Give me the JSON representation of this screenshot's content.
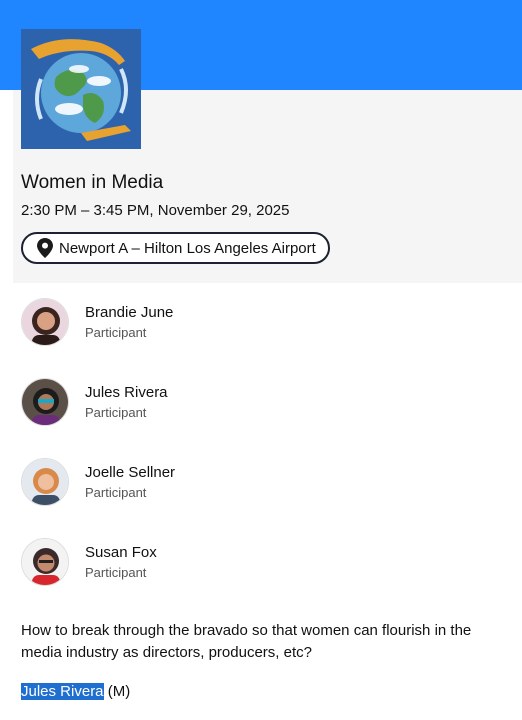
{
  "event": {
    "title": "Women in Media",
    "datetime": "2:30 PM – 3:45 PM, November 29, 2025",
    "location": "Newport A – Hilton Los Angeles Airport",
    "description": "How to break through the bravado so that women can flourish in the media industry as directors, producers, etc?",
    "moderator_name": "Jules Rivera",
    "moderator_tag": "(M)"
  },
  "participants": [
    {
      "name": "Brandie June",
      "role": "Participant"
    },
    {
      "name": "Jules Rivera",
      "role": "Participant"
    },
    {
      "name": "Joelle Sellner",
      "role": "Participant"
    },
    {
      "name": "Susan Fox",
      "role": "Participant"
    }
  ],
  "colors": {
    "top_band": "#1f86ff",
    "card_bg": "#f5f5f5",
    "selection": "#1f6fd1"
  },
  "icons": {
    "location": "map-pin-icon"
  }
}
